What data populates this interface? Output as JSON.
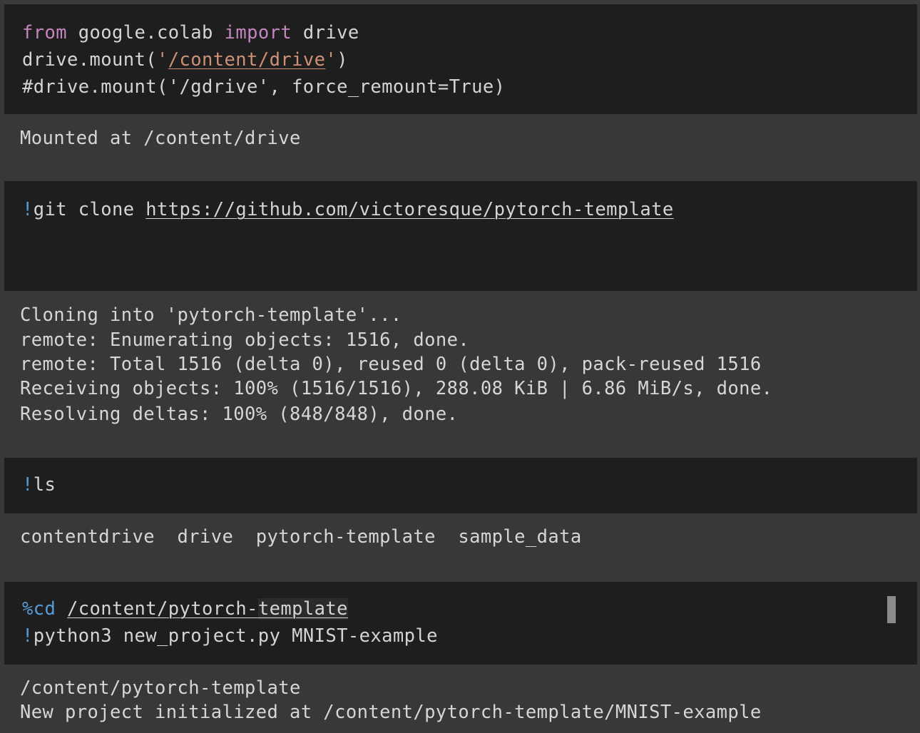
{
  "cells": {
    "mount": {
      "line1": {
        "kw_from": "from",
        "module": " google.colab ",
        "kw_import": "import",
        "name": " drive"
      },
      "line2": {
        "call": "drive.mount(",
        "q1": "'",
        "path": "/content/drive",
        "q2": "'",
        "close": ")"
      },
      "line3": "#drive.mount('/gdrive', force_remount=True)",
      "output": "Mounted at /content/drive"
    },
    "clone": {
      "bang": "!",
      "cmd": "git clone ",
      "url": "https://github.com/victoresque/pytorch-template",
      "output": [
        "Cloning into 'pytorch-template'...",
        "remote: Enumerating objects: 1516, done.",
        "remote: Total 1516 (delta 0), reused 0 (delta 0), pack-reused 1516",
        "Receiving objects: 100% (1516/1516), 288.08 KiB | 6.86 MiB/s, done.",
        "Resolving deltas: 100% (848/848), done."
      ]
    },
    "ls": {
      "bang": "!",
      "cmd": "ls",
      "output": "contentdrive  drive  pytorch-template  sample_data"
    },
    "cd": {
      "magic": "%cd",
      "space": " ",
      "path_a": "/content/pytorch-",
      "path_b": "template",
      "bang": "!",
      "cmd2": "python3 new_project.py MNIST-example",
      "output": [
        "/content/pytorch-template",
        "New project initialized at /content/pytorch-template/MNIST-example"
      ]
    }
  },
  "colors": {
    "editor_bg": "#1e1e1e",
    "output_bg": "#383838",
    "keyword": "#c586c0",
    "string": "#ce9178",
    "comment": "#6a9955",
    "magic": "#569cd6"
  }
}
